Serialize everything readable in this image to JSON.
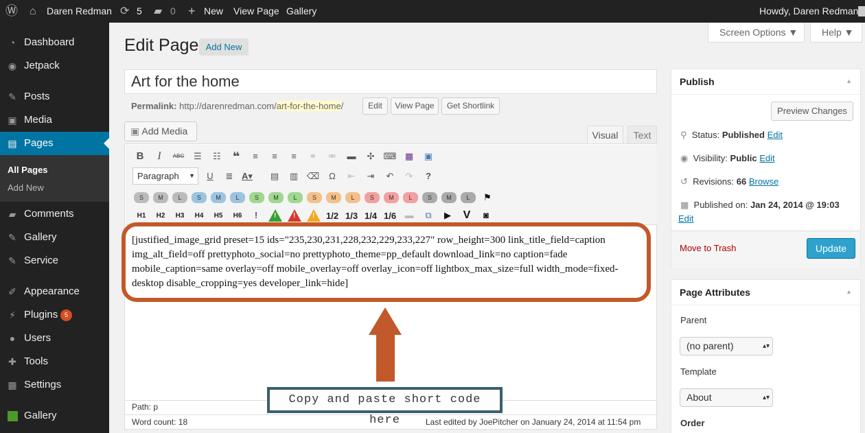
{
  "adminbar": {
    "site_name": "Daren Redman",
    "updates_count": "5",
    "comments_count": "0",
    "new_label": "New",
    "view_page": "View Page",
    "gallery": "Gallery",
    "howdy": "Howdy, Daren Redman"
  },
  "sidebar": {
    "items": [
      {
        "label": "Dashboard"
      },
      {
        "label": "Jetpack"
      },
      {
        "label": "Posts"
      },
      {
        "label": "Media"
      },
      {
        "label": "Pages"
      },
      {
        "label": "Comments"
      },
      {
        "label": "Gallery"
      },
      {
        "label": "Service"
      },
      {
        "label": "Appearance"
      },
      {
        "label": "Plugins"
      },
      {
        "label": "Users"
      },
      {
        "label": "Tools"
      },
      {
        "label": "Settings"
      },
      {
        "label": "Gallery"
      }
    ],
    "submenu": [
      "All Pages",
      "Add New"
    ],
    "plugins_badge": "5"
  },
  "screen_meta": {
    "screen_options": "Screen Options ▼",
    "help": "Help ▼"
  },
  "header": {
    "title": "Edit Page",
    "add_new": "Add New"
  },
  "post": {
    "title": "Art for the home",
    "permalink_label": "Permalink:",
    "permalink_base": "http://darenredman.com/",
    "permalink_slug": "art-for-the-home",
    "permalink_trail": "/",
    "edit_btn": "Edit",
    "view_btn": "View Page",
    "shortlink_btn": "Get Shortlink"
  },
  "editor": {
    "add_media": "Add Media",
    "tab_visual": "Visual",
    "tab_text": "Text",
    "format_select": "Paragraph",
    "headings": [
      "H1",
      "H2",
      "H3",
      "H4",
      "H5",
      "H6"
    ],
    "fractions": [
      "1/2",
      "1/3",
      "1/4",
      "1/6"
    ],
    "content": "[justified_image_grid preset=15 ids=\"235,230,231,228,232,229,233,227\" row_height=300 link_title_field=caption img_alt_field=off prettyphoto_social=no prettyphoto_theme=pp_default download_link=no caption=fade mobile_caption=same overlay=off mobile_overlay=off overlay_icon=off lightbox_max_size=full width_mode=fixed-desktop disable_cropping=yes developer_link=hide]",
    "path": "Path: p",
    "word_count": "Word count: 18",
    "last_edited": "Last edited by JoePitcher on January 24, 2014 at 11:54 pm"
  },
  "annotation": {
    "callout": "Copy and paste short code here"
  },
  "publish": {
    "title": "Publish",
    "preview": "Preview Changes",
    "status_label": "Status:",
    "status_value": "Published",
    "visibility_label": "Visibility:",
    "visibility_value": "Public",
    "revisions_label": "Revisions:",
    "revisions_value": "66",
    "browse": "Browse",
    "published_label": "Published on:",
    "published_value": "Jan 24, 2014 @ 19:03",
    "edit": "Edit",
    "trash": "Move to Trash",
    "update": "Update"
  },
  "attributes": {
    "title": "Page Attributes",
    "parent_label": "Parent",
    "parent_value": "(no parent)",
    "template_label": "Template",
    "template_value": "About",
    "order_label": "Order"
  },
  "colors": {
    "accent": "#0074a2",
    "annotation": "#c2592a",
    "callout_border": "#3a5f6e"
  }
}
